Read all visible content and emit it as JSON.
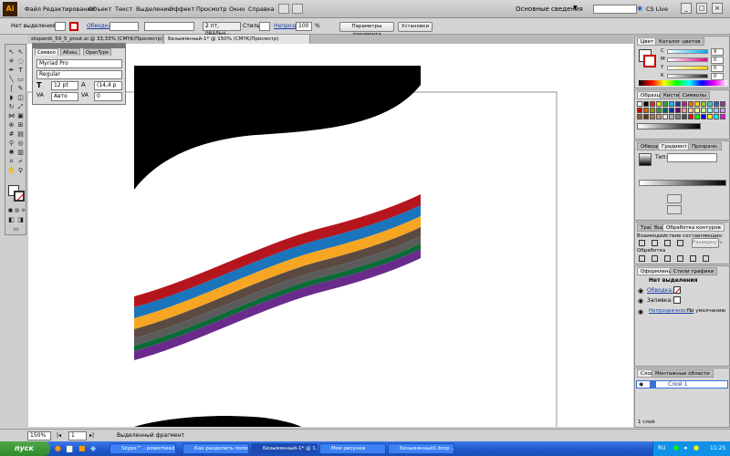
{
  "menubar": {
    "logo": "Ai",
    "items": [
      "Файл",
      "Редактирование",
      "Объект",
      "Текст",
      "Выделение",
      "Эффект",
      "Просмотр",
      "Окно",
      "Справка"
    ],
    "workspace": "Основные сведения",
    "cslive": "CS Live"
  },
  "controlbar": {
    "selection": "Нет выделения",
    "stroke_label": "Обводка:",
    "brush": "2 пт, овальн...",
    "style_label": "Стиль:",
    "opacity_label": "Непрозр.:",
    "opacity_value": "100",
    "percent": "%",
    "doc_settings": "Параметры документа",
    "preferences": "Установки"
  },
  "tabs": [
    {
      "label": "stopanik_59_5_prost.ai @ 33,33% (CMYK/Просмотр)",
      "active": false
    },
    {
      "label": "Безымянный-1* @ 150% (CMYK/Просмотр)",
      "active": true
    }
  ],
  "char_panel": {
    "tabs": [
      "Символ",
      "Абзац",
      "OpenType"
    ],
    "font": "Myriad Pro",
    "style": "Regular",
    "size": "12 pt",
    "leading": "(14,4 p",
    "kerning": "Авто",
    "tracking": "0"
  },
  "color_panel": {
    "tabs": [
      "Цвет",
      "Каталог цветов"
    ],
    "channels": [
      {
        "label": "C",
        "value": "9",
        "color": "#00aeef"
      },
      {
        "label": "M",
        "value": "0",
        "color": "#ec008c"
      },
      {
        "label": "Y",
        "value": "0",
        "color": "#ffd200"
      },
      {
        "label": "K",
        "value": "0",
        "color": "#222222"
      }
    ]
  },
  "swatches_panel": {
    "tabs": [
      "Образцы",
      "Кисти",
      "Символы"
    ]
  },
  "gradient_panel": {
    "tabs": [
      "Обводка",
      "Градиент",
      "Прозрачн."
    ],
    "type_label": "Тип:"
  },
  "pathfinder_panel": {
    "tabs": [
      "Трансф.",
      "Выравн.",
      "Обработка контуров"
    ],
    "shape_modes": "Взаимодействие составляющих:",
    "expand": "Развернуть",
    "pathfinders": "Обработка"
  },
  "appearance_panel": {
    "tabs": [
      "Оформление",
      "Стили графики"
    ],
    "selection": "Нет выделения",
    "stroke": "Обводка:",
    "fill": "Заливка:",
    "opacity": "Непрозрачность:",
    "opacity_value": "По умолчанию"
  },
  "layers_panel": {
    "tabs": [
      "Слои",
      "Монтажные области"
    ],
    "layer_name": "Слой 1",
    "footer": "1 слой"
  },
  "statusbar": {
    "zoom": "150%",
    "artboard": "1",
    "info": "Выделенный фрагмент"
  },
  "taskbar": {
    "start": "пуск",
    "tasks": [
      {
        "label": "Skype™ - powerhead...",
        "active": false
      },
      {
        "label": "Как разделить поло...",
        "active": false
      },
      {
        "label": "Безымянный-1* @ 1...",
        "active": true
      },
      {
        "label": "Мои рисунки",
        "active": false
      },
      {
        "label": "Безымянный1.bmp ...",
        "active": false
      }
    ],
    "lang": "RU",
    "time": "11:25"
  },
  "stripes": {
    "colors": [
      "#b5161d",
      "#1b75bc",
      "#f6a623",
      "#5a4a42",
      "#5b5b5b",
      "#0a6b36",
      "#6a2b8c"
    ]
  }
}
